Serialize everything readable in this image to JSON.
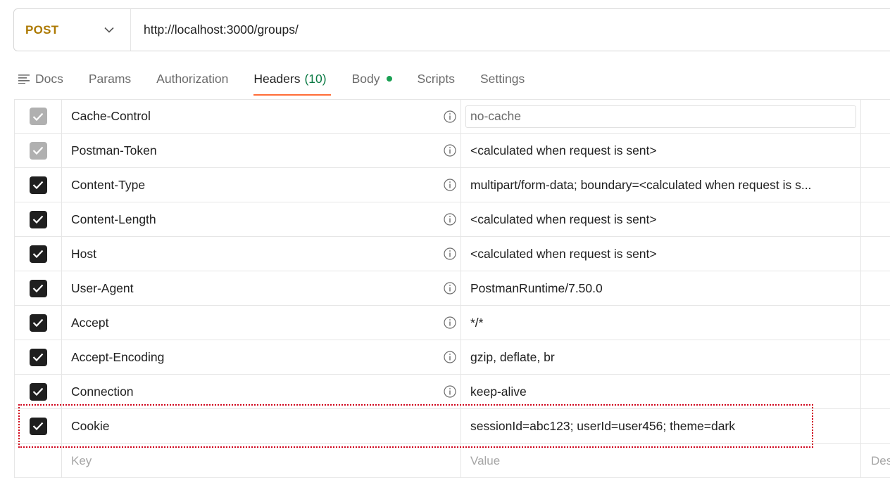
{
  "request": {
    "method": "POST",
    "url": "http://localhost:3000/groups/"
  },
  "tabs": [
    {
      "label": "Docs",
      "icon": "docs-icon"
    },
    {
      "label": "Params"
    },
    {
      "label": "Authorization"
    },
    {
      "label": "Headers",
      "count": "(10)",
      "active": true
    },
    {
      "label": "Body",
      "indicator": "green-dot"
    },
    {
      "label": "Scripts"
    },
    {
      "label": "Settings"
    }
  ],
  "headers": [
    {
      "key": "Cache-Control",
      "value": "no-cache",
      "checked": true,
      "locked": true
    },
    {
      "key": "Postman-Token",
      "value": "<calculated when request is sent>",
      "checked": true,
      "locked": true
    },
    {
      "key": "Content-Type",
      "value": "multipart/form-data; boundary=<calculated when request is s...",
      "checked": true
    },
    {
      "key": "Content-Length",
      "value": "<calculated when request is sent>",
      "checked": true
    },
    {
      "key": "Host",
      "value": "<calculated when request is sent>",
      "checked": true
    },
    {
      "key": "User-Agent",
      "value": "PostmanRuntime/7.50.0",
      "checked": true
    },
    {
      "key": "Accept",
      "value": "*/*",
      "checked": true
    },
    {
      "key": "Accept-Encoding",
      "value": "gzip, deflate, br",
      "checked": true
    },
    {
      "key": "Connection",
      "value": "keep-alive",
      "checked": true
    },
    {
      "key": "Cookie",
      "value": "sessionId=abc123; userId=user456; theme=dark",
      "checked": true
    }
  ],
  "new_row": {
    "key_placeholder": "Key",
    "value_placeholder": "Value",
    "desc_placeholder": "Des"
  },
  "colors": {
    "method": "#ad7a03",
    "tab_active_underline": "#ff6c37",
    "header_count": "#0b7a44",
    "body_dot": "#1aa053",
    "highlight_border": "#d0021b"
  }
}
